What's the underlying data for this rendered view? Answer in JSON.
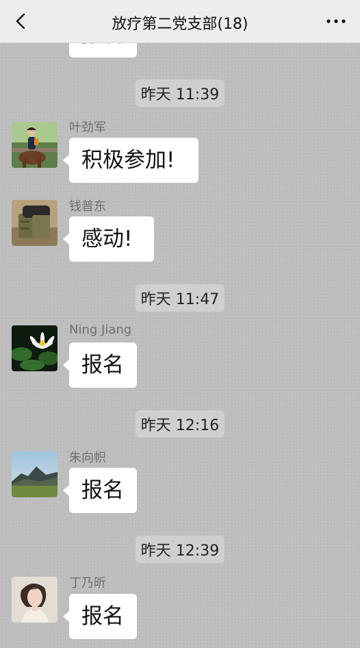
{
  "header": {
    "title": "放疗第二党支部(18)",
    "back_icon": "chevron-left",
    "more_icon": "more-horizontal"
  },
  "messages": [
    {
      "kind": "partial",
      "text": "报名"
    },
    {
      "kind": "timestamp",
      "text": "昨天 11:39"
    },
    {
      "kind": "message",
      "sender": "叶劲军",
      "text": "积极参加!",
      "avatar": "horse-rider-photo"
    },
    {
      "kind": "message",
      "sender": "钱普东",
      "text": "感动!",
      "avatar": "bag-photo"
    },
    {
      "kind": "timestamp",
      "text": "昨天 11:47"
    },
    {
      "kind": "message",
      "sender": "Ning Jiang",
      "text": "报名",
      "avatar": "lotus-photo"
    },
    {
      "kind": "timestamp",
      "text": "昨天 12:16"
    },
    {
      "kind": "message",
      "sender": "朱向帜",
      "text": "报名",
      "avatar": "landscape-photo"
    },
    {
      "kind": "timestamp",
      "text": "昨天 12:39"
    },
    {
      "kind": "message",
      "sender": "丁乃昕",
      "text": "报名",
      "avatar": "portrait-photo"
    }
  ]
}
